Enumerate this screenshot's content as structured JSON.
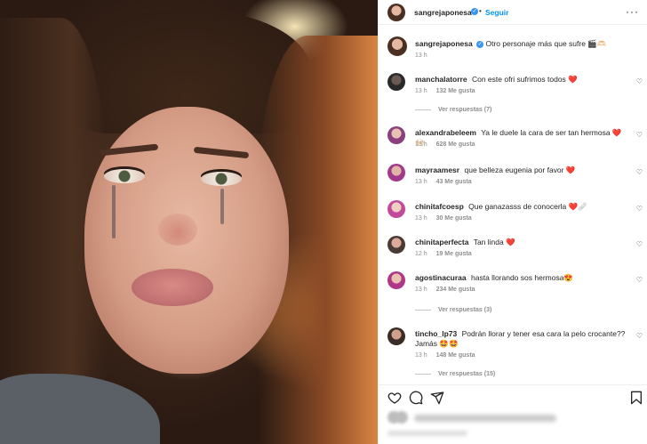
{
  "post": {
    "username": "sangrejaponesa",
    "verified": true,
    "follow_label": "Seguir",
    "caption": "Otro personaje más que sufre 🎬🫶🏻",
    "caption_time": "13 h"
  },
  "comments": [
    {
      "username": "manchalatorre",
      "text": "Con este ofri sufrimos todos ❤️",
      "time": "13 h",
      "likes": "132 Me gusta",
      "replies": "Ver respuestas (7)"
    },
    {
      "username": "alexandrabeleem",
      "text": "Ya le duele la cara de ser tan hermosa ❤️ 🙌🏻",
      "time": "13 h",
      "likes": "628 Me gusta",
      "replies": ""
    },
    {
      "username": "mayraamesr",
      "text": "que belleza eugenia por favor ❤️",
      "time": "13 h",
      "likes": "43 Me gusta",
      "replies": ""
    },
    {
      "username": "chinitafcoesp",
      "text": "Que ganazasss de conocerla ❤️🩹",
      "time": "13 h",
      "likes": "30 Me gusta",
      "replies": ""
    },
    {
      "username": "chinitaperfecta",
      "text": "Tan linda ❤️",
      "time": "12 h",
      "likes": "19 Me gusta",
      "replies": ""
    },
    {
      "username": "agostinacuraa",
      "text": "hasta llorando sos hermosa😍",
      "time": "13 h",
      "likes": "234 Me gusta",
      "replies": "Ver respuestas (3)"
    },
    {
      "username": "tincho_lp73",
      "text": "Podrán llorar y tener esa cara la pelo crocante?? Jamás 🤩🤩",
      "time": "13 h",
      "likes": "148 Me gusta",
      "replies": "Ver respuestas (15)"
    }
  ],
  "icons": {
    "like": "heart-icon",
    "comment": "comment-icon",
    "share": "share-icon",
    "save": "bookmark-icon",
    "more": "more-options-icon",
    "comment_like": "heart-icon"
  },
  "colors": {
    "accent": "#0095f6",
    "verified": "#3897f0",
    "muted": "#8e8e8e",
    "text": "#262626"
  }
}
